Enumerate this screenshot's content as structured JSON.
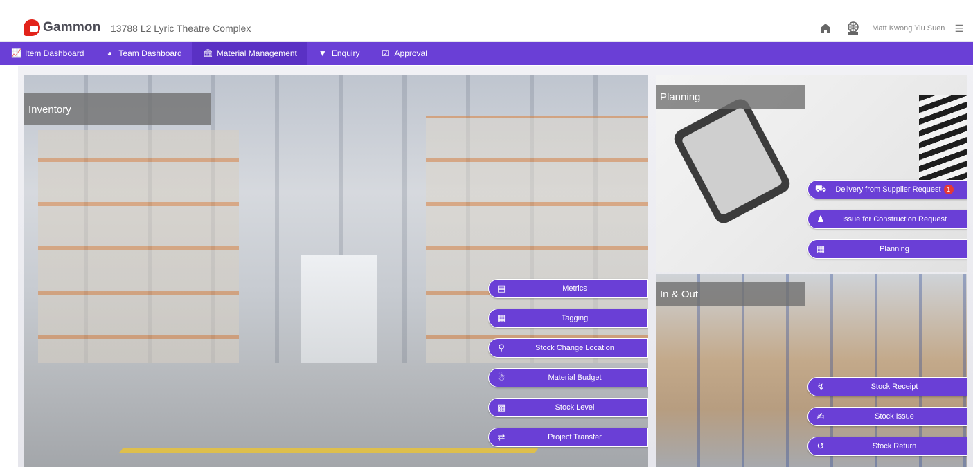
{
  "header": {
    "logo_text": "Gammon",
    "project_title": "13788 L2 Lyric Theatre Complex",
    "user_name": "Matt Kwong Yiu Suen",
    "icons": {
      "home": "home-icon",
      "language": "globe-icon",
      "menu": "hamburger-menu-icon"
    }
  },
  "nav": {
    "tabs": [
      {
        "label": "Item Dashboard",
        "icon": "line-chart-icon"
      },
      {
        "label": "Team Dashboard",
        "icon": "pie-chart-icon"
      },
      {
        "label": "Material Management",
        "icon": "warehouse-icon",
        "active": true
      },
      {
        "label": "Enquiry",
        "icon": "filter-icon"
      },
      {
        "label": "Approval",
        "icon": "checkbox-icon"
      }
    ]
  },
  "inventory": {
    "title": "Inventory",
    "buttons": [
      {
        "label": "Metrics",
        "icon": "area-chart-icon"
      },
      {
        "label": "Tagging",
        "icon": "qr-code-icon"
      },
      {
        "label": "Stock Change Location",
        "icon": "route-icon"
      },
      {
        "label": "Material Budget",
        "icon": "money-bag-icon"
      },
      {
        "label": "Stock Level",
        "icon": "bar-chart-icon"
      },
      {
        "label": "Project Transfer",
        "icon": "shuffle-icon"
      }
    ]
  },
  "planning": {
    "title": "Planning",
    "buttons": [
      {
        "label": "Delivery from Supplier Request",
        "icon": "truck-icon",
        "badge": "1"
      },
      {
        "label": "Issue for Construction Request",
        "icon": "people-carry-icon"
      },
      {
        "label": "Planning",
        "icon": "calendar-icon"
      }
    ]
  },
  "inout": {
    "title": "In & Out",
    "buttons": [
      {
        "label": "Stock Receipt",
        "icon": "dolly-icon"
      },
      {
        "label": "Stock Issue",
        "icon": "hand-box-icon"
      },
      {
        "label": "Stock Return",
        "icon": "undo-icon"
      }
    ]
  },
  "colors": {
    "primary": "#6a3fd6",
    "nav_active": "#5a31c4",
    "brand_red": "#e2231a",
    "badge": "#e53935"
  }
}
